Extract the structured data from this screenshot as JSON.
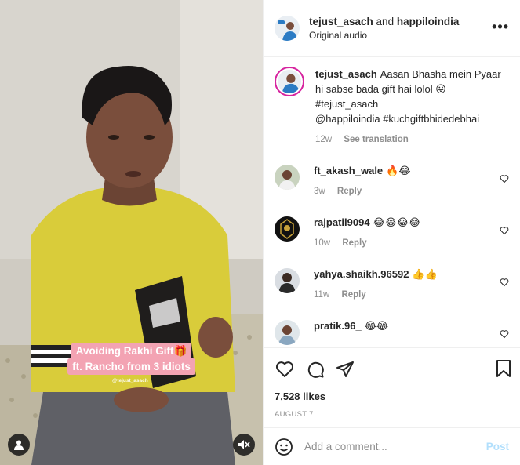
{
  "media": {
    "caption_line1": "Avoiding Rakhi Gift🎁",
    "caption_line2": "ft. Rancho from 3 idiots",
    "watermark": "@tejust_asach",
    "user_icon": "user-icon",
    "mute_icon": "speaker-muted-icon"
  },
  "header": {
    "author1": "tejust_asach",
    "and_text": " and ",
    "author2": "happiloindia",
    "audio": "Original audio",
    "more_icon": "more-options-icon",
    "more_label": "•••"
  },
  "post_caption": {
    "username": "tejust_asach",
    "text_line1": "Aasan Bhasha mein Pyaar hi sabse bada gift hai lolol 😛",
    "text_line2": "#tejust_asach",
    "text_line3": "@happiloindia #kuchgiftbhidedebhai",
    "time": "12w",
    "translate": "See translation"
  },
  "comments": [
    {
      "username": "ft_akash_wale",
      "text": "🔥😂",
      "time": "3w",
      "reply": "Reply"
    },
    {
      "username": "rajpatil9094",
      "text": "😂😂😂😂",
      "time": "10w",
      "reply": "Reply"
    },
    {
      "username": "yahya.shaikh.96592",
      "text": "👍👍",
      "time": "11w",
      "reply": "Reply"
    },
    {
      "username": "pratik.96_",
      "text": "😂😂",
      "time": "",
      "reply": ""
    }
  ],
  "actions": {
    "like_icon": "heart-icon",
    "comment_icon": "comment-icon",
    "share_icon": "share-icon",
    "save_icon": "bookmark-icon",
    "likes": "7,528 likes",
    "date": "AUGUST 7"
  },
  "add_comment": {
    "emoji_icon": "smiley-icon",
    "placeholder": "Add a comment...",
    "post_label": "Post"
  },
  "colors": {
    "caption_bg": "#f3a3b3",
    "shirt": "#d9cc3a",
    "post_disabled": "#b2dffc",
    "muted_text": "#8e8e8e"
  }
}
